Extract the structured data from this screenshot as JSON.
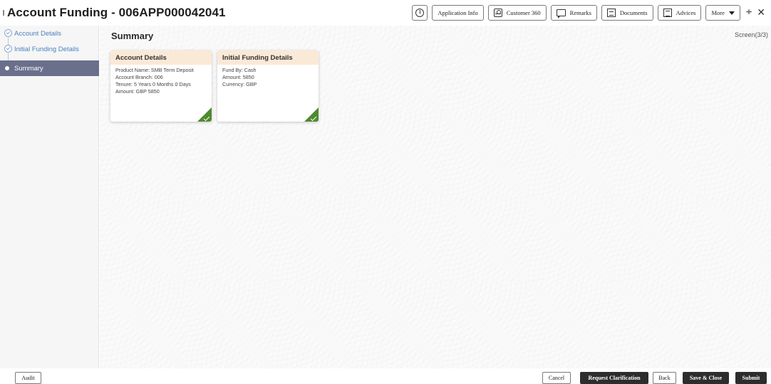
{
  "header": {
    "title": "Account Funding - 006APP000042041",
    "buttons": {
      "application_info": "Application Info",
      "customer_360": "Customer 360",
      "remarks": "Remarks",
      "documents": "Documents",
      "advices": "Advices",
      "more": "More"
    }
  },
  "sidebar": {
    "steps": [
      {
        "label": "Account Details",
        "state": "completed"
      },
      {
        "label": "Initial Funding Details",
        "state": "completed"
      },
      {
        "label": "Summary",
        "state": "active"
      }
    ]
  },
  "main": {
    "title": "Summary",
    "screen_indicator": "Screen(3/3)",
    "cards": [
      {
        "title": "Account Details",
        "lines": [
          "Product Name: SMB Term Deposit",
          "Account Branch: 006",
          "Tenure: 5 Years 0 Months 0 Days",
          "Amount: GBP 5850"
        ],
        "completed": true
      },
      {
        "title": "Initial Funding Details",
        "lines": [
          "Fund By: Cash",
          "Amount: 5850",
          "Currency: GBP"
        ],
        "completed": true
      }
    ]
  },
  "footer": {
    "audit": "Audit",
    "cancel": "Cancel",
    "request_clarification": "Request Clarification",
    "back": "Back",
    "save_close": "Save & Close",
    "submit": "Submit"
  },
  "colors": {
    "active_step_bg": "#6a6f8c",
    "card_header_bg": "#fbe9d7",
    "check_green": "#4e8a2e",
    "step_link": "#4a7fc0",
    "primary_button": "#2d2d2d"
  },
  "icons": {
    "application_info": "info-icon",
    "customer_360": "person-card-icon",
    "remarks": "chat-icon",
    "documents": "documents-icon",
    "advices": "advices-icon",
    "more": "caret-down-icon",
    "minimize": "minimize-icon",
    "close": "close-icon"
  }
}
